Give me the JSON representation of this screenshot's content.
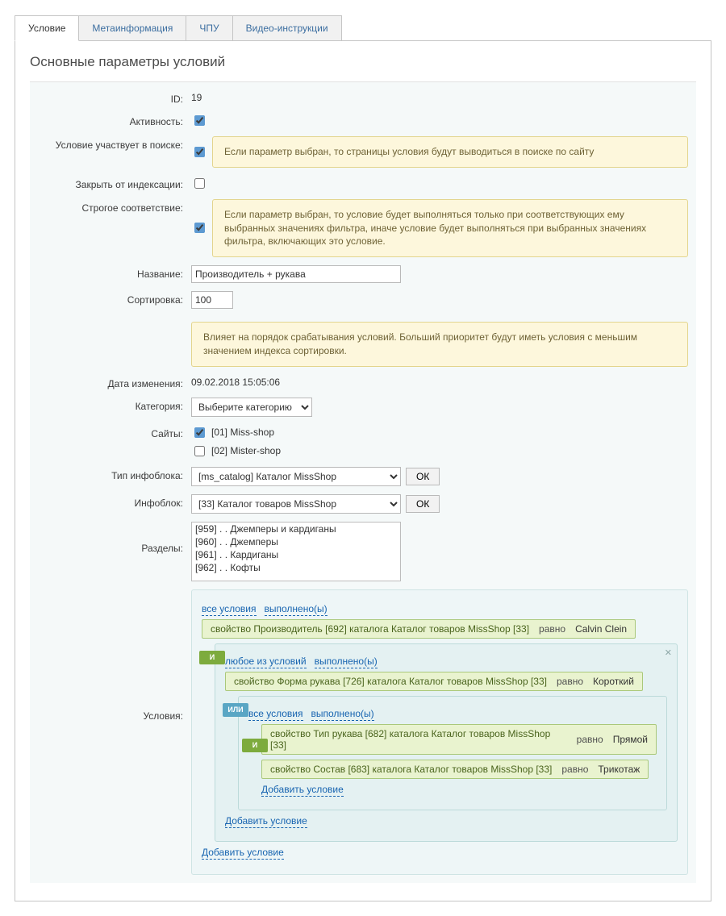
{
  "tabs": [
    "Условие",
    "Метаинформация",
    "ЧПУ",
    "Видео-инструкции"
  ],
  "heading": "Основные параметры условий",
  "labels": {
    "id": "ID:",
    "active": "Активность:",
    "in_search": "Условие участвует в поиске:",
    "noindex": "Закрыть от индексации:",
    "strict": "Строгое соответствие:",
    "name": "Название:",
    "sort": "Сортировка:",
    "changed": "Дата изменения:",
    "category": "Категория:",
    "sites": "Сайты:",
    "ibtype": "Тип инфоблока:",
    "iblock": "Инфоблок:",
    "sections": "Разделы:",
    "conditions": "Условия:"
  },
  "values": {
    "id": "19",
    "name": "Производитель + рукава",
    "sort": "100",
    "changed": "09.02.2018 15:05:06",
    "category_placeholder": "Выберите категорию",
    "ibtype": "[ms_catalog] Каталог MissShop",
    "iblock": "[33] Каталог товаров MissShop"
  },
  "notes": {
    "search": "Если параметр выбран, то страницы условия будут выводиться в поиске по сайту",
    "strict": "Если параметр выбран, то условие будет выполняться только при соответствующих ему выбранных значениях фильтра, иначе условие будет выполняться при выбранных значениях фильтра, включающих это условие.",
    "sort": "Влияет на порядок срабатывания условий. Больший приоритет будут иметь условия с меньшим значением индекса сортировки."
  },
  "sites": {
    "s1": {
      "checked": true,
      "label": "[01] Miss-shop"
    },
    "s2": {
      "checked": false,
      "label": "[02] Mister-shop"
    }
  },
  "sections": [
    "[959] . . Джемперы и кардиганы",
    "[960] . . Джемперы",
    "[961] . . Кардиганы",
    "[962] . . Кофты"
  ],
  "buttons": {
    "ok": "ОК"
  },
  "cond": {
    "all_conditions": "все условия",
    "fulfilled": "выполнено(ы)",
    "any_condition": "любое из условий",
    "add": "Добавить условие",
    "and": "И",
    "or": "ИЛИ",
    "eq": "равно",
    "rule1_prop": "свойство Производитель [692] каталога Каталог товаров MissShop [33]",
    "rule1_val": "Calvin Clein",
    "rule2_prop": "свойство Форма рукава [726] каталога Каталог товаров MissShop [33]",
    "rule2_val": "Короткий",
    "rule3_prop": "свойство Тип рукава [682] каталога Каталог товаров MissShop [33]",
    "rule3_val": "Прямой",
    "rule4_prop": "свойство Состав [683] каталога Каталог товаров MissShop [33]",
    "rule4_val": "Трикотаж"
  }
}
